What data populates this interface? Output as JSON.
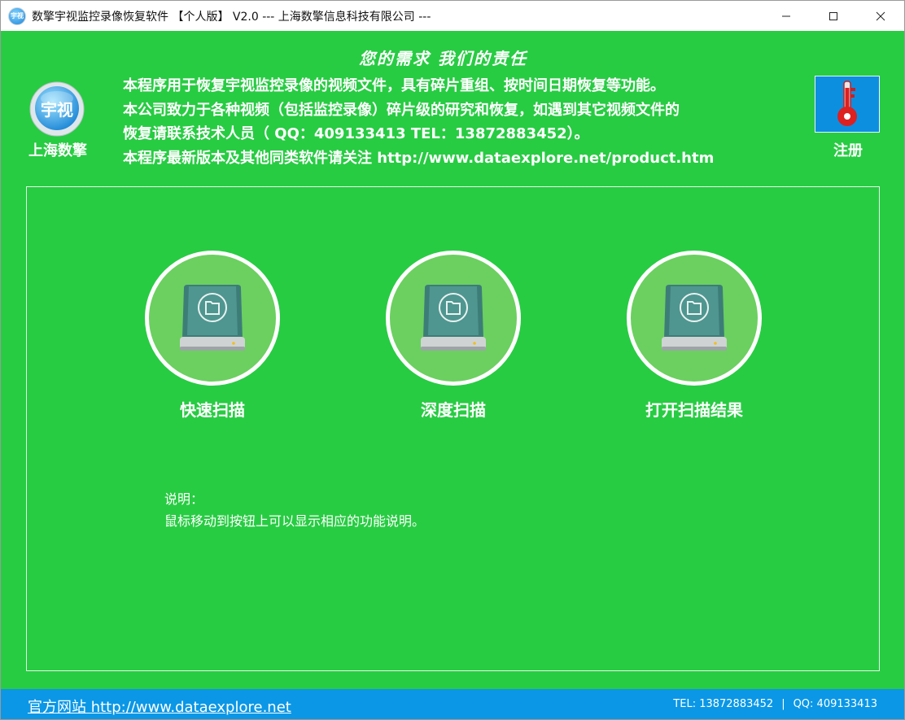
{
  "window": {
    "title": "数擎宇视监控录像恢复软件 【个人版】 V2.0 --- 上海数擎信息科技有限公司 ---",
    "app_icon_text": "宇视"
  },
  "header": {
    "slogan": "您的需求   我们的责任",
    "logo_text": "宇视",
    "logo_caption": "上海数擎",
    "intro_lines": [
      "本程序用于恢复宇视监控录像的视频文件，具有碎片重组、按时间日期恢复等功能。",
      "本公司致力于各种视频（包括监控录像）碎片级的研究和恢复，如遇到其它视频文件的",
      "恢复请联系技术人员（ QQ：409133413  TEL：13872883452）。",
      "本程序最新版本及其他同类软件请关注 http://www.dataexplore.net/product.htm"
    ],
    "register_label": "注册",
    "register_icon": "key-icon"
  },
  "actions": [
    {
      "label": "快速扫描",
      "icon": "hard-drive-icon"
    },
    {
      "label": "深度扫描",
      "icon": "hard-drive-icon"
    },
    {
      "label": "打开扫描结果",
      "icon": "hard-drive-icon"
    }
  ],
  "description": {
    "title": "说明：",
    "text": "鼠标移动到按钮上可以显示相应的功能说明。"
  },
  "footer": {
    "site_text": "官方网站 http://www.dataexplore.net",
    "tel": "TEL: 13872883452",
    "separator": "|",
    "qq": "QQ: 409133413"
  },
  "colors": {
    "background": "#27cc42",
    "circle_fill": "#6bd060",
    "footer": "#0b97e6",
    "register_bg": "#0d8fe0"
  }
}
